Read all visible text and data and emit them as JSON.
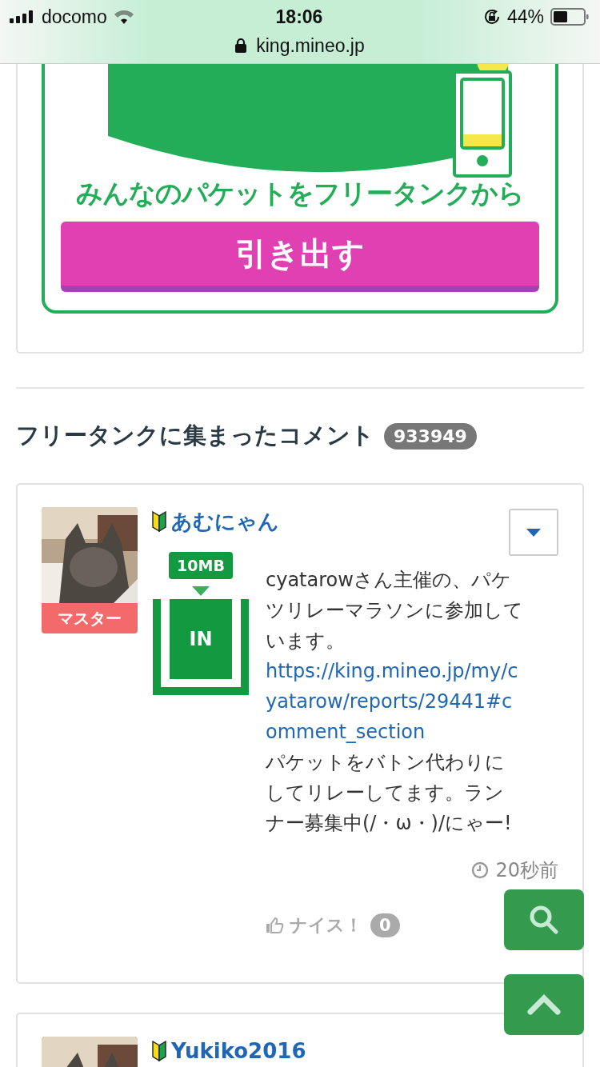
{
  "status_bar": {
    "carrier": "docomo",
    "time": "18:06",
    "battery": "44%",
    "url": "king.mineo.jp"
  },
  "banner": {
    "tagline": "みんなのパケットをフリータンクから",
    "button": "引き出す"
  },
  "comments_section": {
    "title": "フリータンクに集まったコメント",
    "count": "933949"
  },
  "comments": [
    {
      "user": "あむにゃん",
      "rank": "マスター",
      "beginner": true,
      "amount": "10MB",
      "direction": "IN",
      "text_before": "cyatarowさん主催の、パケツリレーマラソンに参加しています。",
      "link": "https://king.mineo.jp/my/cyatarow/reports/29441#comment_section",
      "text_after": "パケットをバトン代わりにしてリレーしてます。ランナー募集中(/・ω・)/にゃー!",
      "time": "20秒前",
      "nice_label": "ナイス！",
      "nice_count": "0"
    },
    {
      "user": "Yukiko2016",
      "beginner": true
    }
  ]
}
